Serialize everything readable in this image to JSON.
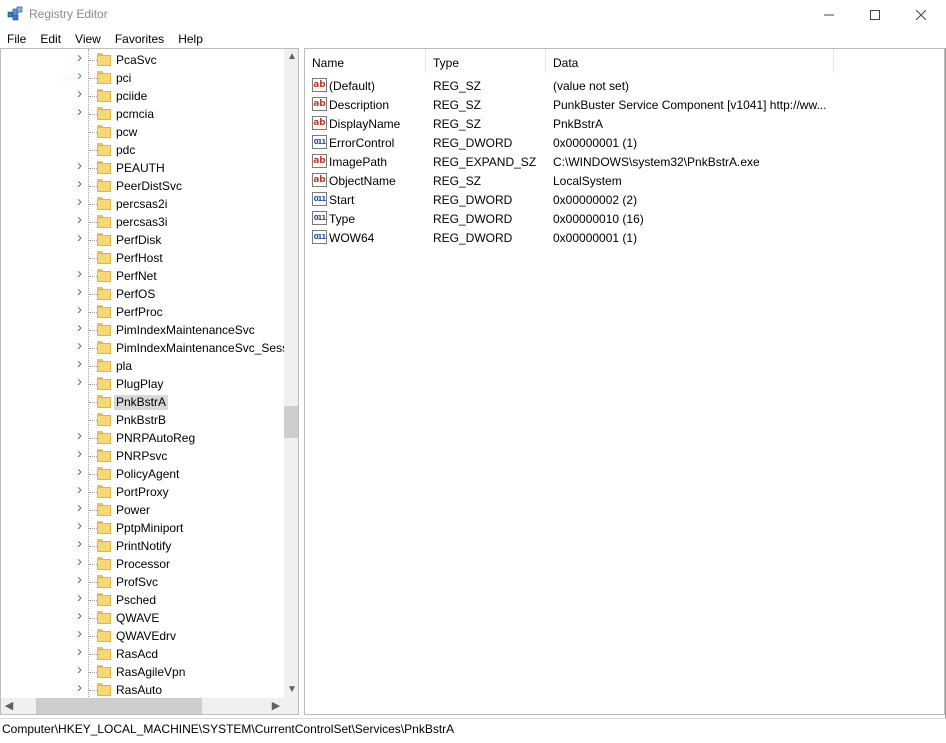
{
  "window": {
    "title": "Registry Editor"
  },
  "menu": [
    "File",
    "Edit",
    "View",
    "Favorites",
    "Help"
  ],
  "tree": {
    "items": [
      {
        "label": "PcaSvc",
        "expander": true,
        "selected": false
      },
      {
        "label": "pci",
        "expander": true,
        "selected": false,
        "highlight": true
      },
      {
        "label": "pciide",
        "expander": true,
        "selected": false
      },
      {
        "label": "pcmcia",
        "expander": true,
        "selected": false
      },
      {
        "label": "pcw",
        "expander": false,
        "selected": false
      },
      {
        "label": "pdc",
        "expander": false,
        "selected": false
      },
      {
        "label": "PEAUTH",
        "expander": true,
        "selected": false
      },
      {
        "label": "PeerDistSvc",
        "expander": true,
        "selected": false
      },
      {
        "label": "percsas2i",
        "expander": true,
        "selected": false
      },
      {
        "label": "percsas3i",
        "expander": true,
        "selected": false
      },
      {
        "label": "PerfDisk",
        "expander": true,
        "selected": false
      },
      {
        "label": "PerfHost",
        "expander": false,
        "selected": false
      },
      {
        "label": "PerfNet",
        "expander": true,
        "selected": false
      },
      {
        "label": "PerfOS",
        "expander": true,
        "selected": false
      },
      {
        "label": "PerfProc",
        "expander": true,
        "selected": false
      },
      {
        "label": "PimIndexMaintenanceSvc",
        "expander": true,
        "selected": false
      },
      {
        "label": "PimIndexMaintenanceSvc_Sessi",
        "expander": true,
        "selected": false
      },
      {
        "label": "pla",
        "expander": true,
        "selected": false
      },
      {
        "label": "PlugPlay",
        "expander": true,
        "selected": false
      },
      {
        "label": "PnkBstrA",
        "expander": false,
        "selected": true
      },
      {
        "label": "PnkBstrB",
        "expander": false,
        "selected": false
      },
      {
        "label": "PNRPAutoReg",
        "expander": true,
        "selected": false
      },
      {
        "label": "PNRPsvc",
        "expander": true,
        "selected": false
      },
      {
        "label": "PolicyAgent",
        "expander": true,
        "selected": false
      },
      {
        "label": "PortProxy",
        "expander": true,
        "selected": false
      },
      {
        "label": "Power",
        "expander": true,
        "selected": false
      },
      {
        "label": "PptpMiniport",
        "expander": true,
        "selected": false
      },
      {
        "label": "PrintNotify",
        "expander": true,
        "selected": false
      },
      {
        "label": "Processor",
        "expander": true,
        "selected": false
      },
      {
        "label": "ProfSvc",
        "expander": true,
        "selected": false
      },
      {
        "label": "Psched",
        "expander": true,
        "selected": false
      },
      {
        "label": "QWAVE",
        "expander": true,
        "selected": false
      },
      {
        "label": "QWAVEdrv",
        "expander": true,
        "selected": false
      },
      {
        "label": "RasAcd",
        "expander": true,
        "selected": false
      },
      {
        "label": "RasAgileVpn",
        "expander": true,
        "selected": false
      },
      {
        "label": "RasAuto",
        "expander": true,
        "selected": false
      }
    ]
  },
  "values": {
    "columns": {
      "name": "Name",
      "type": "Type",
      "data": "Data"
    },
    "rows": [
      {
        "icon": "string-value-icon",
        "name": "(Default)",
        "type": "REG_SZ",
        "data": "(value not set)"
      },
      {
        "icon": "string-value-icon",
        "name": "Description",
        "type": "REG_SZ",
        "data": "PunkBuster Service Component [v1041] http://ww..."
      },
      {
        "icon": "string-value-icon",
        "name": "DisplayName",
        "type": "REG_SZ",
        "data": "PnkBstrA"
      },
      {
        "icon": "binary-value-icon",
        "name": "ErrorControl",
        "type": "REG_DWORD",
        "data": "0x00000001 (1)"
      },
      {
        "icon": "string-value-icon",
        "name": "ImagePath",
        "type": "REG_EXPAND_SZ",
        "data": "C:\\WINDOWS\\system32\\PnkBstrA.exe"
      },
      {
        "icon": "string-value-icon",
        "name": "ObjectName",
        "type": "REG_SZ",
        "data": "LocalSystem"
      },
      {
        "icon": "binary-value-icon",
        "name": "Start",
        "type": "REG_DWORD",
        "data": "0x00000002 (2)"
      },
      {
        "icon": "binary-value-icon",
        "name": "Type",
        "type": "REG_DWORD",
        "data": "0x00000010 (16)"
      },
      {
        "icon": "binary-value-icon",
        "name": "WOW64",
        "type": "REG_DWORD",
        "data": "0x00000001 (1)"
      }
    ]
  },
  "status": {
    "path": "Computer\\HKEY_LOCAL_MACHINE\\SYSTEM\\CurrentControlSet\\Services\\PnkBstrA"
  },
  "colors": {
    "selection": "#d9d9d9",
    "folder": "#f8d775",
    "expander_highlight": "#26a0da"
  }
}
